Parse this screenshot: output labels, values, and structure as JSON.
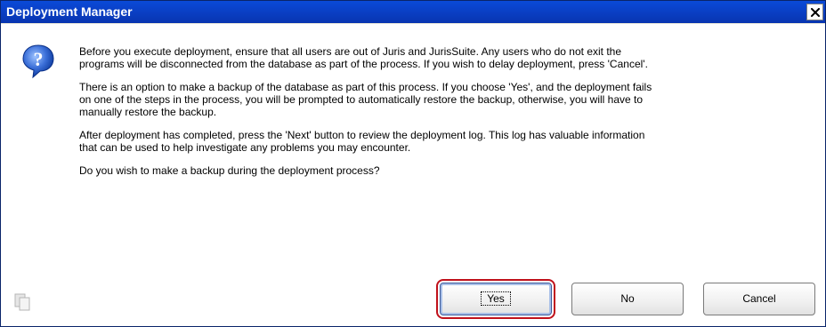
{
  "window": {
    "title": "Deployment Manager"
  },
  "message": {
    "paragraphs": [
      "Before you execute deployment, ensure that all users are out of Juris and JurisSuite.  Any users who do not exit the\nprograms will be disconnected from the database as part of the process.  If you wish to delay deployment, press 'Cancel'.",
      "There is an option to make a backup of the database as part of this process.  If you choose 'Yes', and the deployment fails\non one of the steps in the process, you will be prompted to automatically restore the backup, otherwise, you will have to\nmanually restore the backup.",
      "After deployment has completed, press the 'Next' button to review the deployment log.  This log has valuable information\nthat can be used to help investigate any problems you may encounter.",
      "Do you wish to make a backup during the deployment process?"
    ]
  },
  "buttons": {
    "yes": "Yes",
    "no": "No",
    "cancel": "Cancel"
  },
  "icons": {
    "dialog_icon": "question-icon",
    "copy_icon": "copy-icon",
    "close_icon": "close-icon"
  },
  "colors": {
    "titlebar": "#0a3fc4",
    "highlight": "#c0111b",
    "question_icon": "#1f55c7"
  }
}
